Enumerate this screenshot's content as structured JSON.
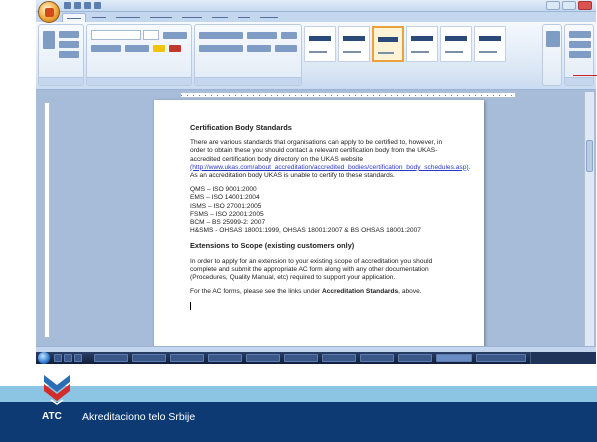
{
  "document": {
    "heading1": "Certification Body Standards",
    "para1": "There are various standards that organisations can apply to be certified to, however, in order to obtain these you should contact a relevant certification body from the UKAS-accredited certification body directory on the UKAS website",
    "link": "(http://www.ukas.com/about_accreditation/accredited_bodies/certification_body_schedules.asp)",
    "para1_tail": ". As an accreditation body UKAS is unable to certify to these standards.",
    "standards": [
      "QMS – ISO 9001:2000",
      "EMS – ISO 14001:2004",
      "ISMS – ISO 27001:2005",
      "FSMS – ISO 22001:2005",
      "BCM – BS 25999-2: 2007",
      "H&SMS - OHSAS 18001:1999, OHSAS 18001:2007 & BS OHSAS 18001:2007"
    ],
    "heading2": "Extensions to Scope (existing customers only)",
    "para2": "In order to apply for an extension to your existing scope of accreditation you should complete and submit the appropriate AC form along with any other documentation (Procedures, Quality Manual, etc) required to support your application.",
    "para3_pre": "For the AC forms, please see the links under ",
    "para3_bold": "Accreditation Standards",
    "para3_post": ", above."
  },
  "slide_footer": {
    "logo_text": "ATC",
    "org_name": "Akreditaciono telo Srbije"
  },
  "colors": {
    "footer_dark": "#0e3a73",
    "footer_light": "#8cc5e4",
    "link": "#2a36c9"
  }
}
